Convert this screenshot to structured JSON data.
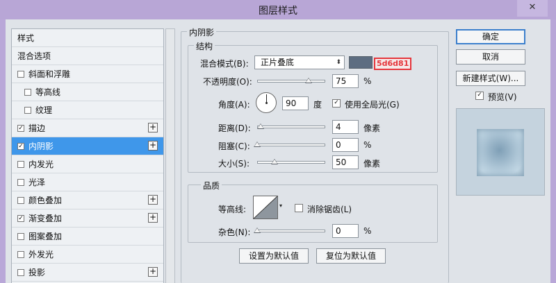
{
  "window": {
    "title": "图层样式",
    "close_glyph": "✕"
  },
  "left_panel": {
    "items": [
      {
        "label": "样式",
        "has_checkbox": false,
        "checked": false,
        "has_plus": false,
        "indent": false,
        "selected": false
      },
      {
        "label": "混合选项",
        "has_checkbox": false,
        "checked": false,
        "has_plus": false,
        "indent": false,
        "selected": false
      },
      {
        "label": "斜面和浮雕",
        "has_checkbox": true,
        "checked": false,
        "has_plus": false,
        "indent": false,
        "selected": false
      },
      {
        "label": "等高线",
        "has_checkbox": true,
        "checked": false,
        "has_plus": false,
        "indent": true,
        "selected": false
      },
      {
        "label": "纹理",
        "has_checkbox": true,
        "checked": false,
        "has_plus": false,
        "indent": true,
        "selected": false
      },
      {
        "label": "描边",
        "has_checkbox": true,
        "checked": true,
        "has_plus": true,
        "indent": false,
        "selected": false
      },
      {
        "label": "内阴影",
        "has_checkbox": true,
        "checked": true,
        "has_plus": true,
        "indent": false,
        "selected": true
      },
      {
        "label": "内发光",
        "has_checkbox": true,
        "checked": false,
        "has_plus": false,
        "indent": false,
        "selected": false
      },
      {
        "label": "光泽",
        "has_checkbox": true,
        "checked": false,
        "has_plus": false,
        "indent": false,
        "selected": false
      },
      {
        "label": "颜色叠加",
        "has_checkbox": true,
        "checked": false,
        "has_plus": true,
        "indent": false,
        "selected": false
      },
      {
        "label": "渐变叠加",
        "has_checkbox": true,
        "checked": true,
        "has_plus": true,
        "indent": false,
        "selected": false
      },
      {
        "label": "图案叠加",
        "has_checkbox": true,
        "checked": false,
        "has_plus": false,
        "indent": false,
        "selected": false
      },
      {
        "label": "外发光",
        "has_checkbox": true,
        "checked": false,
        "has_plus": false,
        "indent": false,
        "selected": false
      },
      {
        "label": "投影",
        "has_checkbox": true,
        "checked": false,
        "has_plus": true,
        "indent": false,
        "selected": false
      }
    ],
    "check_glyph": "✓",
    "plus_glyph": "+"
  },
  "inner_shadow": {
    "section_title": "内阴影",
    "structure": {
      "title": "结构",
      "blend_mode_label": "混合模式(B):",
      "blend_mode_value": "正片叠底",
      "shadow_color": "#5d6d81",
      "shadow_color_label": "5d6d81",
      "opacity_label": "不透明度(O):",
      "opacity_value": "75",
      "opacity_unit": "%",
      "opacity_level": 75,
      "angle_label": "角度(A):",
      "angle_value": "90",
      "angle_unit": "度",
      "global_light_label": "使用全局光(G)",
      "global_light_checked": true,
      "distance_label": "距离(D):",
      "distance_value": "4",
      "distance_unit": "像素",
      "choke_label": "阻塞(C):",
      "choke_value": "0",
      "choke_unit": "%",
      "size_label": "大小(S):",
      "size_value": "50",
      "size_unit": "像素"
    },
    "quality": {
      "title": "品质",
      "contour_label": "等高线:",
      "anti_aliased_label": "消除锯齿(L)",
      "anti_aliased_checked": false,
      "noise_label": "杂色(N):",
      "noise_value": "0",
      "noise_unit": "%"
    },
    "make_default_label": "设置为默认值",
    "reset_default_label": "复位为默认值"
  },
  "right_panel": {
    "ok_label": "确定",
    "cancel_label": "取消",
    "new_style_label": "新建样式(W)...",
    "preview_label": "预览(V)",
    "preview_checked": true
  },
  "icons": {
    "select_arrow": "⬍",
    "contour_arrow": "▾"
  }
}
